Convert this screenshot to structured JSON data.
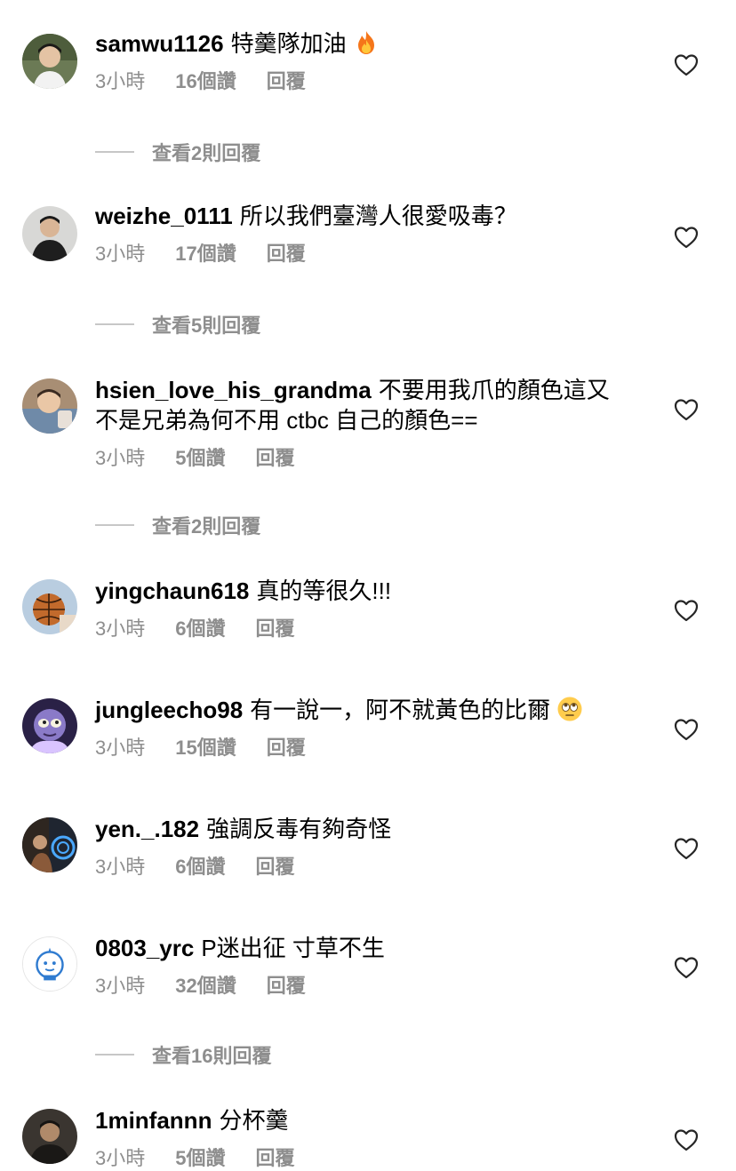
{
  "comments": [
    {
      "username": "samwu1126",
      "text": "特羹隊加油",
      "emoji": "fire-emoji",
      "time": "3小時",
      "likes": "16個讚",
      "reply": "回覆",
      "view_replies": "查看2則回覆",
      "avatar_color": "#4a5a3a"
    },
    {
      "username": "weizhe_0111",
      "text": "所以我們臺灣人很愛吸毒？",
      "time": "3小時",
      "likes": "17個讚",
      "reply": "回覆",
      "view_replies": "查看5則回覆",
      "avatar_color": "#2b2b2b"
    },
    {
      "username": "hsien_love_his_grandma",
      "text": "不要用我爪的顏色這又不是兄弟為何不用 ctbc 自己的顏色==",
      "time": "3小時",
      "likes": "5個讚",
      "reply": "回覆",
      "view_replies": "查看2則回覆",
      "avatar_color": "#8a6a4a"
    },
    {
      "username": "yingchaun618",
      "text": "真的等很久!!!",
      "time": "3小時",
      "likes": "6個讚",
      "reply": "回覆",
      "avatar_color": "#6f8fb0"
    },
    {
      "username": "jungleecho98",
      "text": "有一說一，阿不就黃色的比爾",
      "emoji": "eye-roll-emoji",
      "time": "3小時",
      "likes": "15個讚",
      "reply": "回覆",
      "avatar_color": "#3a2a5a"
    },
    {
      "username": "yen._.182",
      "text": "強調反毒有夠奇怪",
      "time": "3小時",
      "likes": "6個讚",
      "reply": "回覆",
      "avatar_color": "#2a3040"
    },
    {
      "username": "0803_yrc",
      "text": "P迷出征 寸草不生",
      "time": "3小時",
      "likes": "32個讚",
      "reply": "回覆",
      "view_replies": "查看16則回覆",
      "avatar_color": "#ffffff"
    },
    {
      "username": "1minfannn",
      "text": "分杯羹",
      "time": "3小時",
      "likes": "5個讚",
      "reply": "回覆",
      "avatar_color": "#3a3530"
    }
  ],
  "colors": {
    "secondary_text": "#8e8e8e",
    "primary_text": "#000000",
    "divider": "#c7c7c7"
  },
  "icons": {
    "like": "heart-outline-icon"
  }
}
